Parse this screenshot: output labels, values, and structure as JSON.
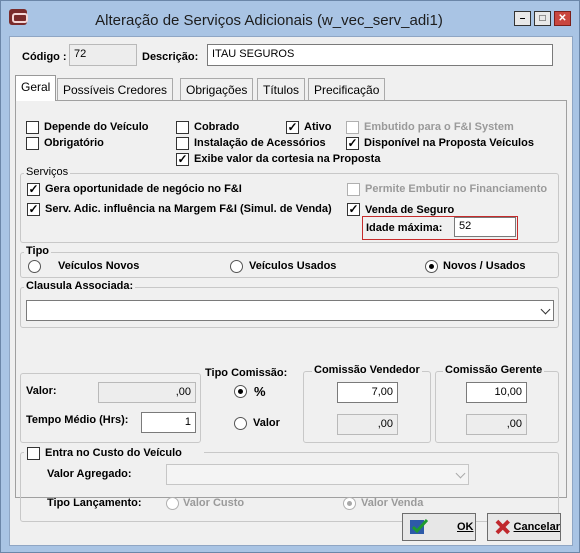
{
  "window": {
    "title": "Alteração de Serviços Adicionais (w_vec_serv_adi1)"
  },
  "header": {
    "codigo_label": "Código :",
    "codigo_value": "72",
    "descricao_label": "Descrição:",
    "descricao_value": "ITAU SEGUROS"
  },
  "tabs": [
    {
      "label": "Geral",
      "active": true
    },
    {
      "label": "Possíveis Credores"
    },
    {
      "label": "Obrigações"
    },
    {
      "label": "Títulos"
    },
    {
      "label": "Precificação"
    }
  ],
  "options": {
    "depende_veiculo": {
      "label": "Depende do Veículo",
      "checked": false
    },
    "obrigatorio": {
      "label": "Obrigatório",
      "checked": false
    },
    "cobrado": {
      "label": "Cobrado",
      "checked": false
    },
    "instalacao": {
      "label": "Instalação de Acessórios",
      "checked": false
    },
    "exibe_valor": {
      "label": "Exibe valor da cortesia na Proposta",
      "checked": true
    },
    "ativo": {
      "label": "Ativo",
      "checked": true
    },
    "disponivel": {
      "label": "Disponível na Proposta Veículos",
      "checked": true
    },
    "embutido": {
      "label": "Embutido para o F&I System",
      "checked": false,
      "disabled": true
    }
  },
  "servicos": {
    "title": "Serviços",
    "gera_oportunidade": {
      "label": "Gera oportunidade de negócio no F&I",
      "checked": true
    },
    "serv_adic": {
      "label": "Serv. Adic. influência na Margem F&I (Simul. de Venda)",
      "checked": true
    },
    "permite_embutir": {
      "label": "Permite Embutir no Financiamento",
      "checked": false,
      "disabled": true
    },
    "venda_seguro": {
      "label": "Venda de Seguro",
      "checked": true
    },
    "idade_label": "Idade máxima:",
    "idade_value": "52"
  },
  "tipo": {
    "title": "Tipo",
    "options": [
      {
        "label": "Veículos Novos",
        "selected": false
      },
      {
        "label": "Veículos Usados",
        "selected": false
      },
      {
        "label": "Novos / Usados",
        "selected": true
      }
    ]
  },
  "clausula": {
    "title": "Clausula Associada:",
    "value": ""
  },
  "valores": {
    "valor_label": "Valor:",
    "valor_value": ",00",
    "tempo_label": "Tempo Médio (Hrs):",
    "tempo_value": "1"
  },
  "tipo_comissao": {
    "title": "Tipo Comissão:",
    "percent_label": "%",
    "valor_label": "Valor",
    "selected": "percent"
  },
  "comissao_vendedor": {
    "title": "Comissão Vendedor",
    "percent": "7,00",
    "valor": ",00"
  },
  "comissao_gerente": {
    "title": "Comissão Gerente",
    "percent": "10,00",
    "valor": ",00"
  },
  "custo": {
    "title": "Entra no Custo do Veículo",
    "checked": false,
    "valor_agregado_label": "Valor Agregado:",
    "valor_agregado_value": "",
    "tipo_lancamento_label": "Tipo Lançamento:",
    "valor_custo_label": "Valor Custo",
    "valor_venda_label": "Valor Venda",
    "selected": "valor_venda"
  },
  "buttons": {
    "ok": "OK",
    "cancel": "Cancelar"
  }
}
